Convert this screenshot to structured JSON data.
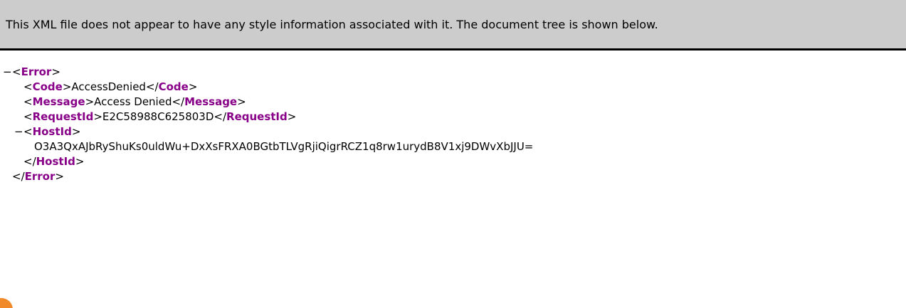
{
  "banner": {
    "text": "This XML file does not appear to have any style information associated with it. The document tree is shown below."
  },
  "tree": {
    "collapse_glyph": "−",
    "root_tag": "Error",
    "children": {
      "code": {
        "tag": "Code",
        "value": "AccessDenied"
      },
      "message": {
        "tag": "Message",
        "value": "Access Denied"
      },
      "request_id": {
        "tag": "RequestId",
        "value": "E2C58988C625803D"
      },
      "host_id": {
        "tag": "HostId",
        "value": "O3A3QxAJbRyShuKs0uldWu+DxXsFRXA0BGtbTLVgRjiQigrRCZ1q8rw1urydB8V1xj9DWvXbJJU="
      }
    }
  },
  "colors": {
    "banner_bg": "#cccccc",
    "tag_name": "#880088"
  }
}
